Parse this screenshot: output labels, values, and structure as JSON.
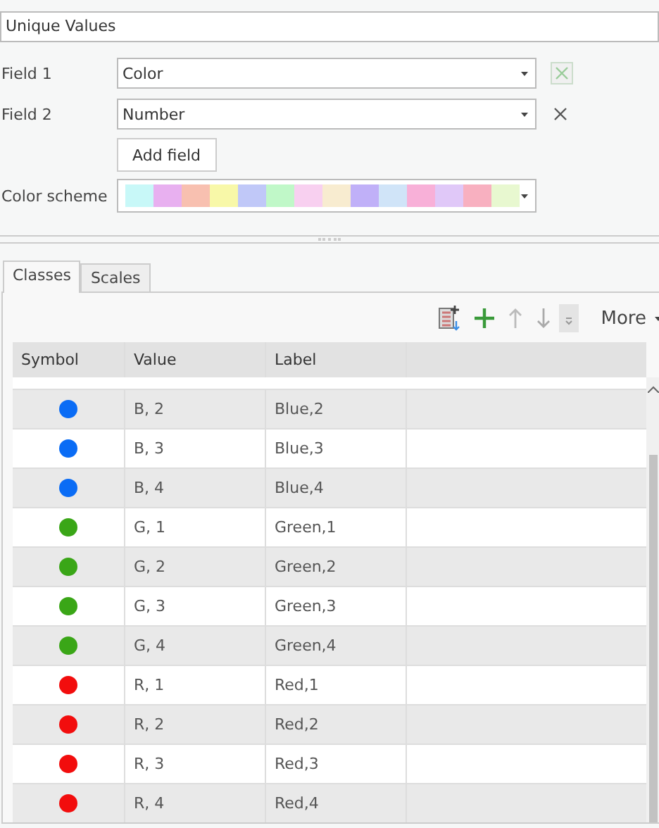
{
  "renderer": {
    "value": "Unique Values"
  },
  "fields": [
    {
      "label": "Field 1",
      "value": "Color",
      "remove_disabled": true
    },
    {
      "label": "Field 2",
      "value": "Number",
      "remove_disabled": false
    }
  ],
  "add_field": "Add field",
  "color_scheme": {
    "label": "Color scheme",
    "swatches": [
      {
        "color": "#c8f8f8"
      },
      {
        "color": "#e8b0f0"
      },
      {
        "color": "#f8c0b0"
      },
      {
        "color": "#f8f8a8"
      },
      {
        "color": "#c0c8f8"
      },
      {
        "color": "#c0f8c8"
      },
      {
        "color": "#f8d0f0"
      },
      {
        "color": "#f8ecd0"
      },
      {
        "color": "#c0b0f8"
      },
      {
        "color": "#d0e4f8"
      },
      {
        "color": "#f8b0d8"
      },
      {
        "color": "#e0c8f8"
      },
      {
        "color": "#f8b0c0"
      },
      {
        "color": "#e8f8d0"
      }
    ]
  },
  "tabs": [
    {
      "label": "Classes",
      "selected": true
    },
    {
      "label": "Scales",
      "selected": false
    }
  ],
  "toolbar": {
    "more": "More"
  },
  "table": {
    "columns": [
      "Symbol",
      "Value",
      "Label"
    ],
    "rows": [
      {
        "color": "#0a6cf5",
        "value": "B, 2",
        "label": "Blue,2"
      },
      {
        "color": "#0a6cf5",
        "value": "B, 3",
        "label": "Blue,3"
      },
      {
        "color": "#0a6cf5",
        "value": "B, 4",
        "label": "Blue,4"
      },
      {
        "color": "#3aa617",
        "value": "G, 1",
        "label": "Green,1"
      },
      {
        "color": "#3aa617",
        "value": "G, 2",
        "label": "Green,2"
      },
      {
        "color": "#3aa617",
        "value": "G, 3",
        "label": "Green,3"
      },
      {
        "color": "#3aa617",
        "value": "G, 4",
        "label": "Green,4"
      },
      {
        "color": "#f20d0d",
        "value": "R, 1",
        "label": "Red,1"
      },
      {
        "color": "#f20d0d",
        "value": "R, 2",
        "label": "Red,2"
      },
      {
        "color": "#f20d0d",
        "value": "R, 3",
        "label": "Red,3"
      },
      {
        "color": "#f20d0d",
        "value": "R, 4",
        "label": "Red,4"
      }
    ]
  }
}
